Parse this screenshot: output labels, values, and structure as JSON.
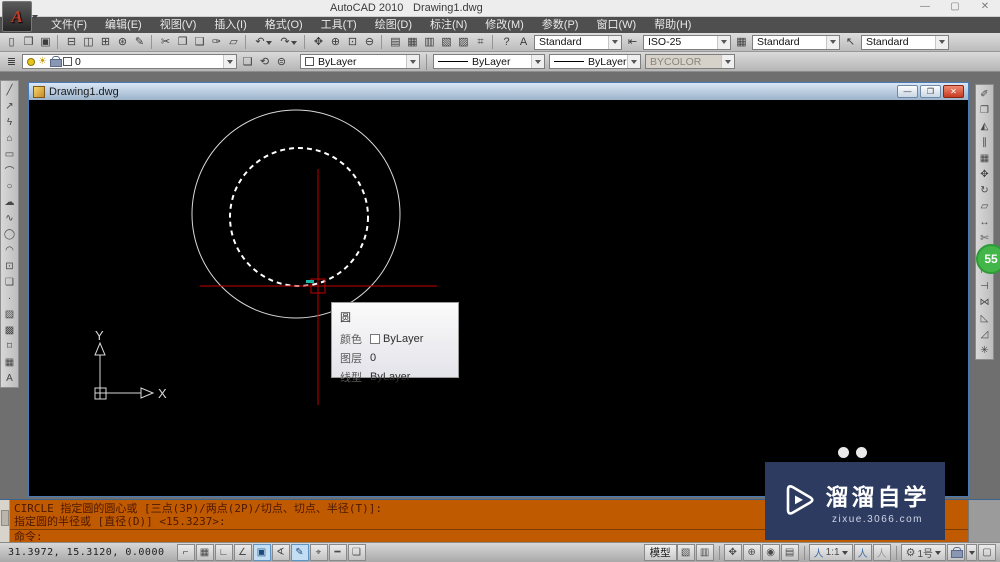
{
  "window": {
    "app_title": "AutoCAD 2010",
    "doc_title": "Drawing1.dwg",
    "controls": [
      {
        "name": "minimize",
        "glyph": "—"
      },
      {
        "name": "maximize",
        "glyph": "▢"
      },
      {
        "name": "close",
        "glyph": "✕"
      }
    ]
  },
  "menu": {
    "items": [
      {
        "name": "file",
        "label": "文件(F)"
      },
      {
        "name": "edit",
        "label": "编辑(E)"
      },
      {
        "name": "view",
        "label": "视图(V)"
      },
      {
        "name": "insert",
        "label": "插入(I)"
      },
      {
        "name": "format",
        "label": "格式(O)"
      },
      {
        "name": "tools",
        "label": "工具(T)"
      },
      {
        "name": "draw",
        "label": "绘图(D)"
      },
      {
        "name": "dimension",
        "label": "标注(N)"
      },
      {
        "name": "modify",
        "label": "修改(M)"
      },
      {
        "name": "parametric",
        "label": "参数(P)"
      },
      {
        "name": "window",
        "label": "窗口(W)"
      },
      {
        "name": "help",
        "label": "帮助(H)"
      }
    ]
  },
  "toolbar1": {
    "icons": [
      {
        "name": "qnew",
        "glyph": "▯"
      },
      {
        "name": "open",
        "glyph": "❒"
      },
      {
        "name": "save",
        "glyph": "▣"
      },
      {
        "name": "separator",
        "glyph": "",
        "sep": true
      },
      {
        "name": "plot",
        "glyph": "⊟"
      },
      {
        "name": "plot-preview",
        "glyph": "◫"
      },
      {
        "name": "publish",
        "glyph": "⊞"
      },
      {
        "name": "3d-dwf",
        "glyph": "⊛"
      },
      {
        "name": "markup",
        "glyph": "✎"
      },
      {
        "name": "separator",
        "glyph": "",
        "sep": true
      },
      {
        "name": "cut",
        "glyph": "✂"
      },
      {
        "name": "copy-clip",
        "glyph": "❐"
      },
      {
        "name": "paste-clip",
        "glyph": "❑"
      },
      {
        "name": "match-properties",
        "glyph": "✑"
      },
      {
        "name": "block-editor",
        "glyph": "▱"
      },
      {
        "name": "separator",
        "glyph": "",
        "sep": true
      },
      {
        "name": "undo",
        "glyph": "↶",
        "dropdown": true
      },
      {
        "name": "redo",
        "glyph": "↷",
        "dropdown": true
      },
      {
        "name": "separator",
        "glyph": "",
        "sep": true
      },
      {
        "name": "pan-realtime",
        "glyph": "✥"
      },
      {
        "name": "zoom-realtime",
        "glyph": "⊕"
      },
      {
        "name": "zoom-window",
        "glyph": "⊡"
      },
      {
        "name": "zoom-previous",
        "glyph": "⊖"
      },
      {
        "name": "separator",
        "glyph": "",
        "sep": true
      },
      {
        "name": "properties",
        "glyph": "▤"
      },
      {
        "name": "designcenter",
        "glyph": "▦"
      },
      {
        "name": "tool-palettes",
        "glyph": "▥"
      },
      {
        "name": "sheet-set-manager",
        "glyph": "▧"
      },
      {
        "name": "markup-set-manager",
        "glyph": "▨"
      },
      {
        "name": "quickcalc",
        "glyph": "⌗"
      },
      {
        "name": "separator",
        "glyph": "",
        "sep": true
      },
      {
        "name": "help",
        "glyph": "?"
      }
    ],
    "styles": [
      {
        "name": "text-style",
        "icon": "A",
        "value": "Standard"
      },
      {
        "name": "dim-style",
        "icon": "⇤",
        "value": "ISO-25"
      },
      {
        "name": "table-style",
        "icon": "▦",
        "value": "Standard"
      },
      {
        "name": "multileader-style",
        "icon": "↖",
        "value": "Standard"
      }
    ]
  },
  "toolbar2": {
    "layer_properties_icon": "≣",
    "layer_combo": {
      "value": "0"
    },
    "layer_tools": [
      {
        "name": "make-object-layer-current",
        "glyph": "❏"
      },
      {
        "name": "layer-previous",
        "glyph": "⟲"
      },
      {
        "name": "layer-states",
        "glyph": "⊜"
      }
    ],
    "color_combo": {
      "value": "ByLayer"
    },
    "linetype_combo": {
      "value": "ByLayer"
    },
    "lineweight_combo": {
      "value": "ByLayer"
    },
    "plotstyle_combo": {
      "value": "BYCOLOR"
    }
  },
  "draw_toolbar": {
    "items": [
      {
        "name": "line",
        "glyph": "╱"
      },
      {
        "name": "construction-line",
        "glyph": "↗"
      },
      {
        "name": "polyline",
        "glyph": "ϟ"
      },
      {
        "name": "polygon",
        "glyph": "⌂"
      },
      {
        "name": "rectangle",
        "glyph": "▭"
      },
      {
        "name": "arc",
        "glyph": "⌒"
      },
      {
        "name": "circle",
        "glyph": "○"
      },
      {
        "name": "revision-cloud",
        "glyph": "☁"
      },
      {
        "name": "spline",
        "glyph": "∿"
      },
      {
        "name": "ellipse",
        "glyph": "◯"
      },
      {
        "name": "ellipse-arc",
        "glyph": "◠"
      },
      {
        "name": "insert-block",
        "glyph": "⊡"
      },
      {
        "name": "make-block",
        "glyph": "❑"
      },
      {
        "name": "point",
        "glyph": "·"
      },
      {
        "name": "hatch",
        "glyph": "▨"
      },
      {
        "name": "gradient",
        "glyph": "▩"
      },
      {
        "name": "region",
        "glyph": "⌑"
      },
      {
        "name": "table",
        "glyph": "▦"
      },
      {
        "name": "multiline-text",
        "glyph": "A"
      }
    ]
  },
  "modify_toolbar": {
    "items": [
      {
        "name": "erase",
        "glyph": "✐"
      },
      {
        "name": "copy",
        "glyph": "❐"
      },
      {
        "name": "mirror",
        "glyph": "◭"
      },
      {
        "name": "offset",
        "glyph": "∥"
      },
      {
        "name": "array",
        "glyph": "▦"
      },
      {
        "name": "move",
        "glyph": "✥"
      },
      {
        "name": "rotate",
        "glyph": "↻"
      },
      {
        "name": "scale",
        "glyph": "▱"
      },
      {
        "name": "stretch",
        "glyph": "↔"
      },
      {
        "name": "trim",
        "glyph": "✄"
      },
      {
        "name": "extend",
        "glyph": "⇥"
      },
      {
        "name": "break-at-point",
        "glyph": "⊢"
      },
      {
        "name": "break",
        "glyph": "⊣"
      },
      {
        "name": "join",
        "glyph": "⋈"
      },
      {
        "name": "chamfer",
        "glyph": "◺"
      },
      {
        "name": "fillet",
        "glyph": "◿"
      },
      {
        "name": "explode",
        "glyph": "✳"
      }
    ]
  },
  "child_window": {
    "title": "Drawing1.dwg",
    "controls": [
      {
        "name": "minimize",
        "glyph": "—",
        "close": false
      },
      {
        "name": "restore",
        "glyph": "❐",
        "close": false
      },
      {
        "name": "close",
        "glyph": "✕",
        "close": true
      }
    ]
  },
  "tooltip": {
    "title": "圆",
    "rows": [
      {
        "label": "颜色",
        "value": "ByLayer",
        "swatch": true
      },
      {
        "label": "图层",
        "value": "0"
      },
      {
        "label": "线型",
        "value": "ByLayer"
      }
    ]
  },
  "ucs": {
    "x_label": "X",
    "y_label": "Y"
  },
  "command": {
    "history": [
      "CIRCLE 指定圆的圆心或 [三点(3P)/两点(2P)/切点、切点、半径(T)]:",
      "指定圆的半径或 [直径(D)] <15.3237>:"
    ],
    "prompt": "命令:"
  },
  "status": {
    "coords": "31.3972, 15.3120, 0.0000",
    "toggles": [
      {
        "name": "snap",
        "glyph": "⌐",
        "active": false
      },
      {
        "name": "grid",
        "glyph": "▦",
        "active": false
      },
      {
        "name": "ortho",
        "glyph": "∟",
        "active": false
      },
      {
        "name": "polar",
        "glyph": "∠",
        "active": false
      },
      {
        "name": "osnap",
        "glyph": "▣",
        "active": true
      },
      {
        "name": "otrack",
        "glyph": "∢",
        "active": false
      },
      {
        "name": "ducs",
        "glyph": "✎",
        "active": true
      },
      {
        "name": "dyn",
        "glyph": "⌖",
        "active": false
      },
      {
        "name": "lwt",
        "glyph": "━",
        "active": false
      },
      {
        "name": "qp",
        "glyph": "❏",
        "active": false
      }
    ],
    "model_label": "模型",
    "quickview": [
      {
        "name": "quick-view-layouts",
        "glyph": "▧"
      },
      {
        "name": "quick-view-drawings",
        "glyph": "▥"
      }
    ],
    "nav": [
      {
        "name": "pan",
        "glyph": "✥"
      },
      {
        "name": "zoom",
        "glyph": "⊕"
      },
      {
        "name": "steering-wheel",
        "glyph": "◉"
      },
      {
        "name": "showmotion",
        "glyph": "▤"
      }
    ],
    "annotation": {
      "person_glyph": "人",
      "scale_label": "1:1",
      "visibility_glyph": "人",
      "autoscale_glyph": "人"
    },
    "workspace": {
      "gear_glyph": "⚙",
      "label": "1号"
    },
    "clean_screen_glyph": "▢"
  },
  "watermark": {
    "title": "溜溜自学",
    "url": "zixue.3066.com"
  },
  "badge": {
    "value": "55"
  },
  "colors": {
    "command_bg": "#c05a00",
    "crosshair_red": "#c00000",
    "close_red": "#c63b22",
    "badge_green": "#43b649",
    "watermark_bg": "#2e3b60",
    "canvas_bg": "#000000"
  }
}
